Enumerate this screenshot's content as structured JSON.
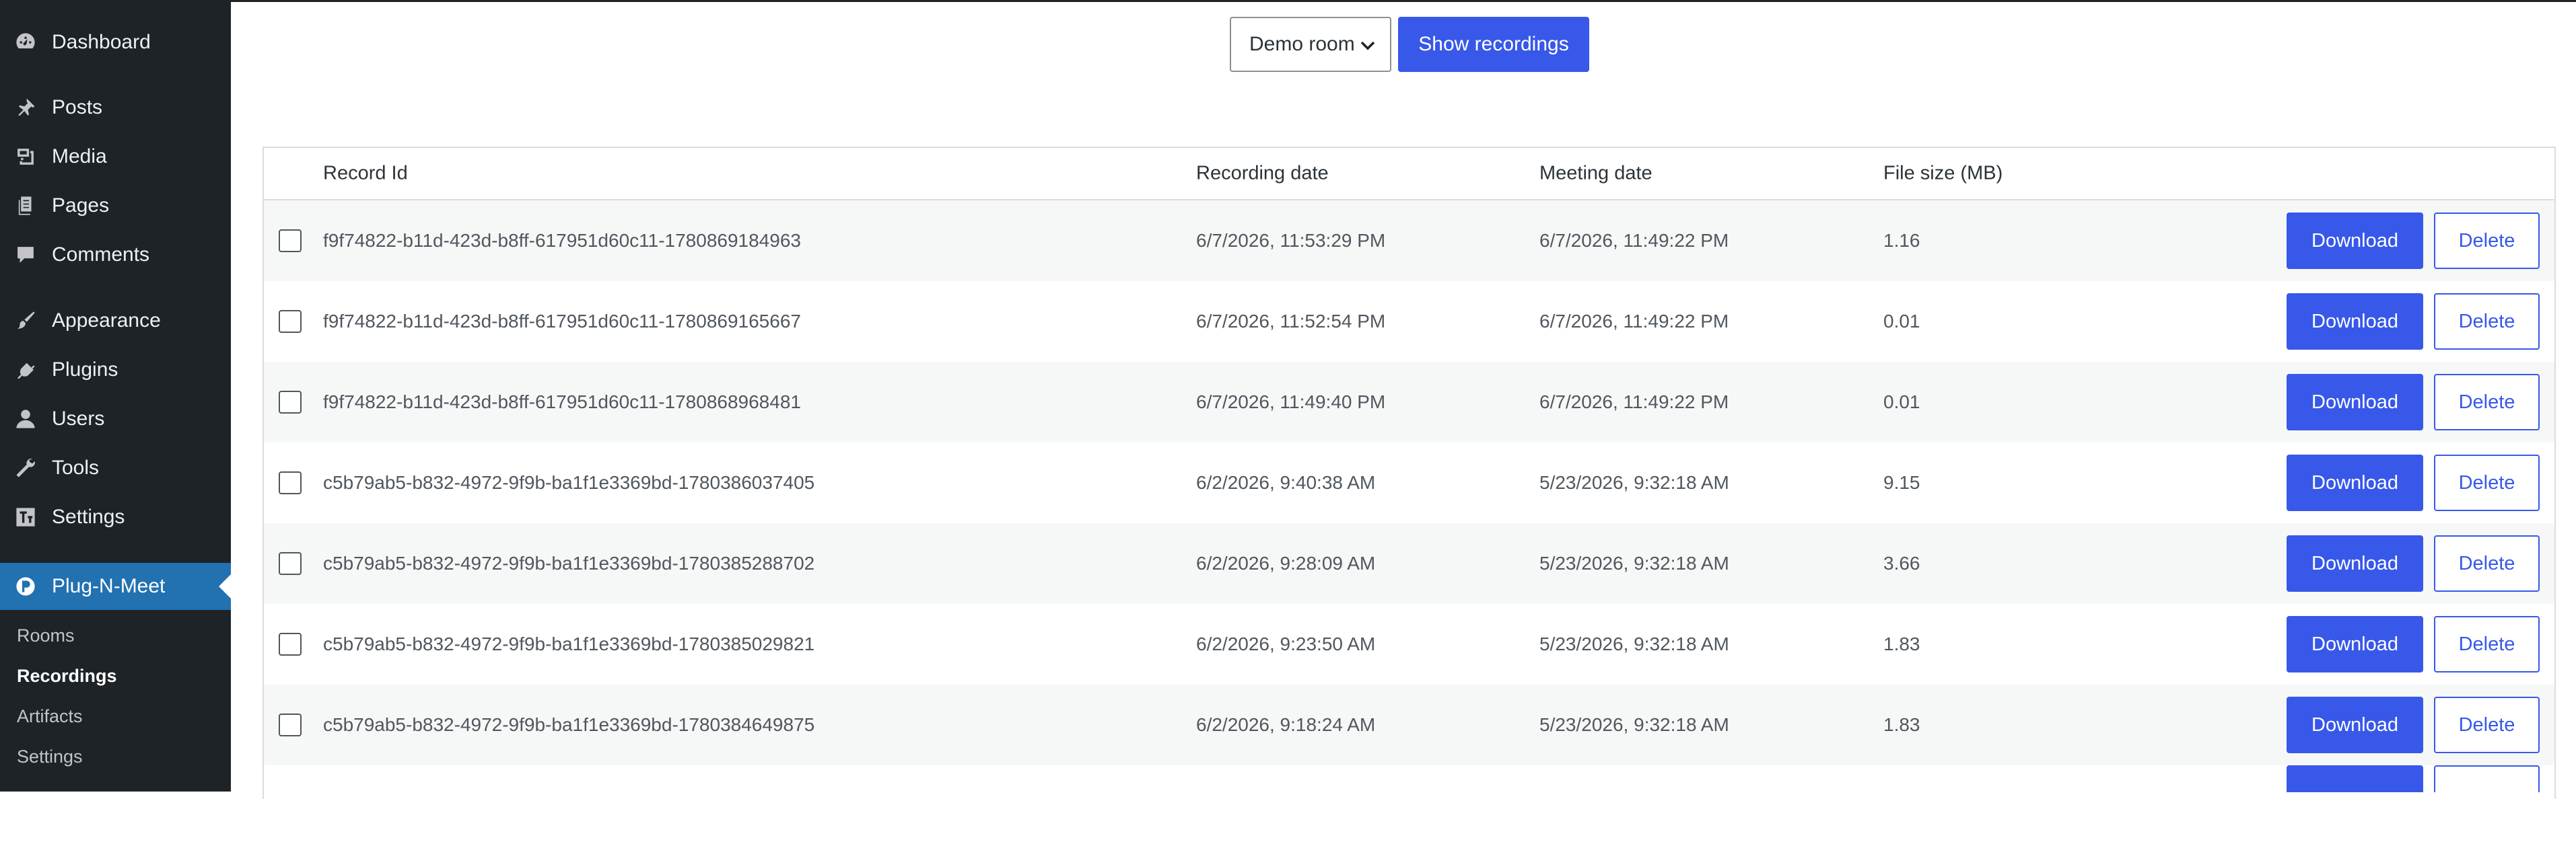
{
  "sidebar": {
    "menu": [
      {
        "label": "Dashboard",
        "icon": "dashboard-icon"
      },
      {
        "label": "Posts",
        "icon": "pin-icon"
      },
      {
        "label": "Media",
        "icon": "media-icon"
      },
      {
        "label": "Pages",
        "icon": "pages-icon"
      },
      {
        "label": "Comments",
        "icon": "comment-icon"
      },
      {
        "label": "Appearance",
        "icon": "brush-icon"
      },
      {
        "label": "Plugins",
        "icon": "plug-icon"
      },
      {
        "label": "Users",
        "icon": "user-icon"
      },
      {
        "label": "Tools",
        "icon": "wrench-icon"
      },
      {
        "label": "Settings",
        "icon": "settings-icon"
      },
      {
        "label": "Plug-N-Meet",
        "icon": "plugnmeet-icon"
      }
    ],
    "submenu": [
      {
        "label": "Rooms"
      },
      {
        "label": "Recordings"
      },
      {
        "label": "Artifacts"
      },
      {
        "label": "Settings"
      }
    ]
  },
  "controls": {
    "room_select": "Demo room",
    "show_button": "Show recordings"
  },
  "table": {
    "headers": [
      "Record Id",
      "Recording date",
      "Meeting date",
      "File size (MB)"
    ],
    "download_label": "Download",
    "delete_label": "Delete",
    "rows": [
      {
        "id": "f9f74822-b11d-423d-b8ff-617951d60c11-1780869184963",
        "recording_date": "6/7/2026, 11:53:29 PM",
        "meeting_date": "6/7/2026, 11:49:22 PM",
        "size": "1.16"
      },
      {
        "id": "f9f74822-b11d-423d-b8ff-617951d60c11-1780869165667",
        "recording_date": "6/7/2026, 11:52:54 PM",
        "meeting_date": "6/7/2026, 11:49:22 PM",
        "size": "0.01"
      },
      {
        "id": "f9f74822-b11d-423d-b8ff-617951d60c11-1780868968481",
        "recording_date": "6/7/2026, 11:49:40 PM",
        "meeting_date": "6/7/2026, 11:49:22 PM",
        "size": "0.01"
      },
      {
        "id": "c5b79ab5-b832-4972-9f9b-ba1f1e3369bd-1780386037405",
        "recording_date": "6/2/2026, 9:40:38 AM",
        "meeting_date": "5/23/2026, 9:32:18 AM",
        "size": "9.15"
      },
      {
        "id": "c5b79ab5-b832-4972-9f9b-ba1f1e3369bd-1780385288702",
        "recording_date": "6/2/2026, 9:28:09 AM",
        "meeting_date": "5/23/2026, 9:32:18 AM",
        "size": "3.66"
      },
      {
        "id": "c5b79ab5-b832-4972-9f9b-ba1f1e3369bd-1780385029821",
        "recording_date": "6/2/2026, 9:23:50 AM",
        "meeting_date": "5/23/2026, 9:32:18 AM",
        "size": "1.83"
      },
      {
        "id": "c5b79ab5-b832-4972-9f9b-ba1f1e3369bd-1780384649875",
        "recording_date": "6/2/2026, 9:18:24 AM",
        "meeting_date": "5/23/2026, 9:32:18 AM",
        "size": "1.83"
      }
    ]
  },
  "colors": {
    "sidebar_bg": "#1d2327",
    "active_menu": "#2271b1",
    "primary_button": "#3858e9",
    "row_alt": "#f6f7f7"
  }
}
